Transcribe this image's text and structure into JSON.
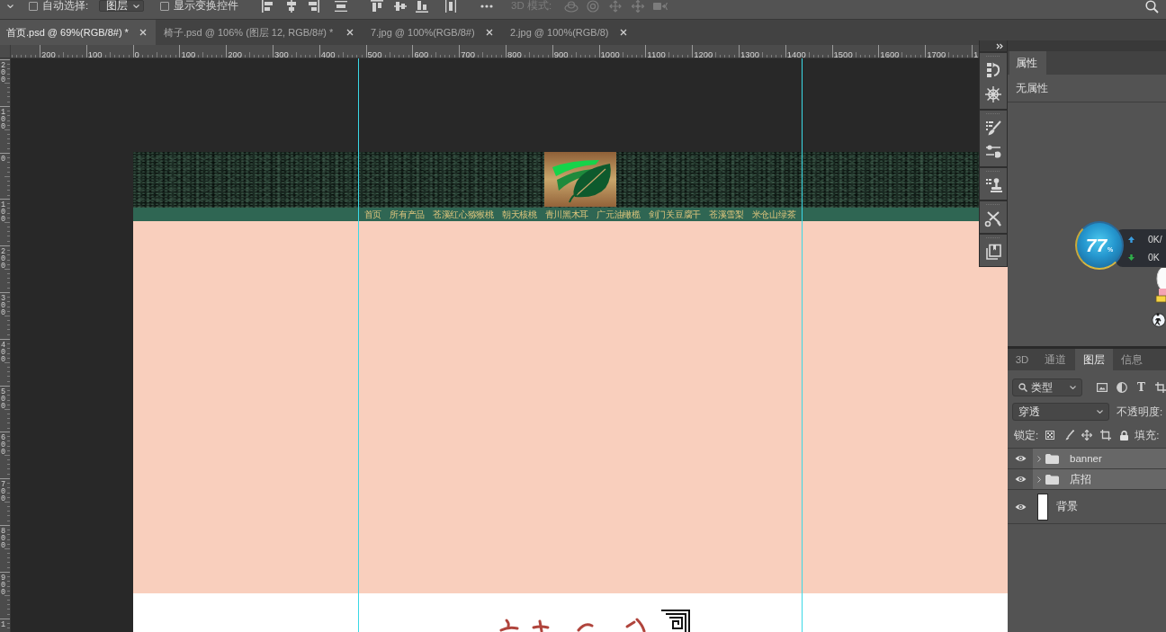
{
  "options_bar": {
    "auto_select": {
      "label": "自动选择:",
      "checked": false
    },
    "auto_select_target": {
      "value": "图层"
    },
    "show_transform": {
      "label": "显示变换控件",
      "checked": false
    },
    "mode_3d": {
      "label": "3D 模式:",
      "disabled": true
    }
  },
  "document_tabs": [
    {
      "label": "首页.psd @ 69%(RGB/8#) *",
      "selected": true
    },
    {
      "label": "椅子.psd @ 106% (图层 12, RGB/8#) *",
      "selected": false
    },
    {
      "label": "7.jpg @ 100%(RGB/8#)",
      "selected": false
    },
    {
      "label": "2.jpg @ 100%(RGB/8)",
      "selected": false
    }
  ],
  "rulers": {
    "horizontal": [
      "200",
      "100",
      "0",
      "100",
      "200",
      "300",
      "400",
      "500",
      "600",
      "700",
      "800",
      "900",
      "1000",
      "1100",
      "1200",
      "1300",
      "1400",
      "1500",
      "1600",
      "1700",
      "1"
    ],
    "vertical": [
      "200",
      "100",
      "0",
      "100",
      "200",
      "300",
      "400",
      "500",
      "600",
      "700",
      "800",
      "900",
      "1"
    ]
  },
  "canvas": {
    "nav_items": [
      "首页",
      "所有产品",
      "苍溪红心猕猴桃",
      "朝天核桃",
      "青川黑木耳",
      "广元油橄榄",
      "剑门关豆腐干",
      "苍溪雪梨",
      "米仓山绿茶"
    ]
  },
  "properties_panel": {
    "tabs": [
      {
        "label": "属性",
        "selected": true
      }
    ],
    "message": "无属性"
  },
  "layers_panel": {
    "tabs": [
      {
        "label": "3D",
        "selected": false
      },
      {
        "label": "通道",
        "selected": false
      },
      {
        "label": "图层",
        "selected": true
      },
      {
        "label": "信息",
        "selected": false
      }
    ],
    "filter": {
      "value": "类型",
      "type_glyph": "T"
    },
    "blend_mode": {
      "value": "穿透"
    },
    "opacity_label": "不透明度:",
    "lock_label": "锁定:",
    "fill_label": "填充:",
    "layers": [
      {
        "name": "banner",
        "kind": "group",
        "visible": true,
        "selected": true
      },
      {
        "name": "店招",
        "kind": "group",
        "visible": true,
        "selected": true
      },
      {
        "name": "背景",
        "kind": "layer",
        "visible": true,
        "selected": false
      }
    ]
  },
  "speed_widget": {
    "percent": "77",
    "unit": "%",
    "upload": "0K/",
    "download": "0K"
  }
}
